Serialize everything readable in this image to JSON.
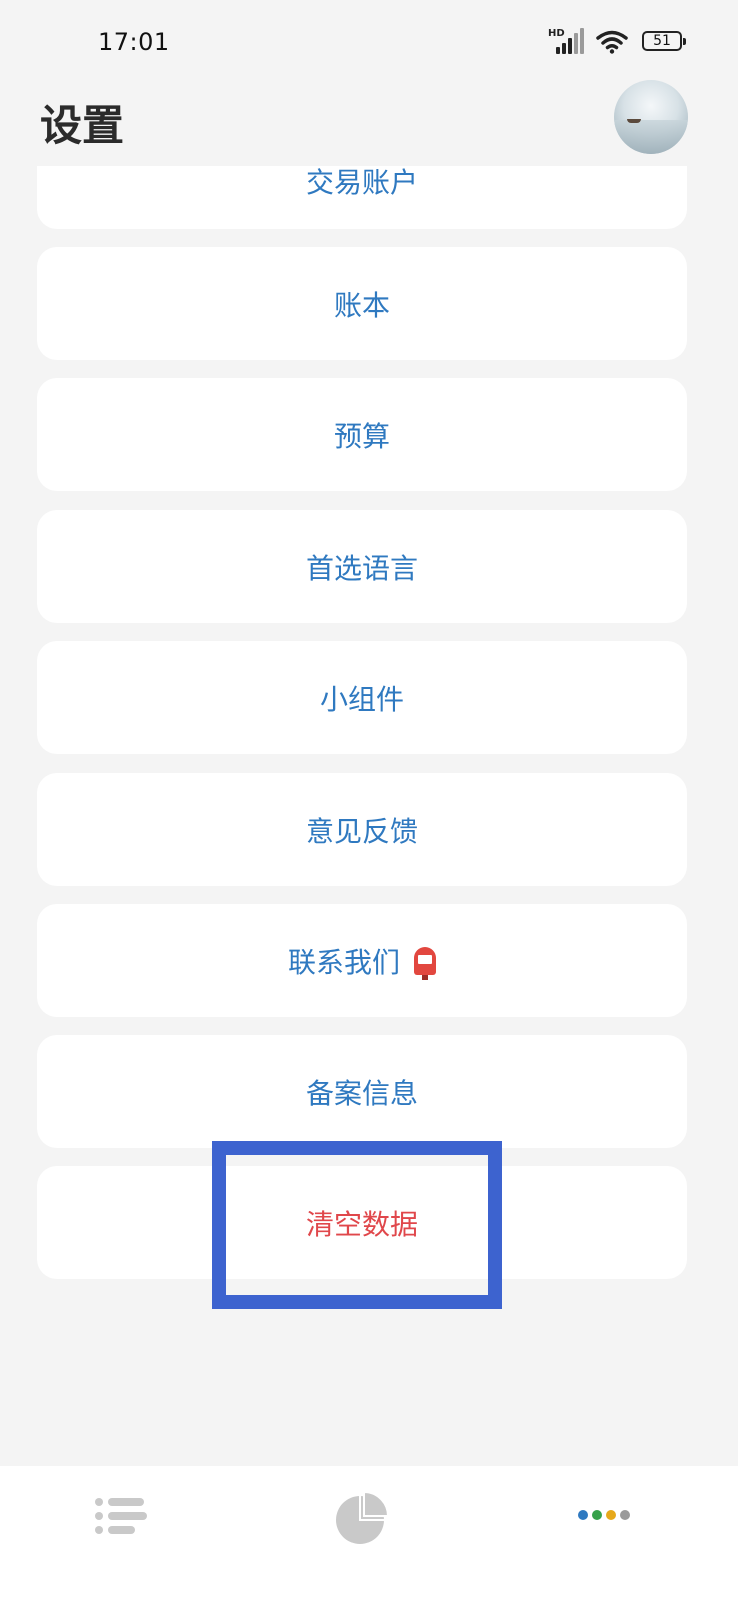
{
  "status_bar": {
    "time": "17:01",
    "network_label": "HD",
    "battery": "51"
  },
  "header": {
    "title": "设置"
  },
  "settings": {
    "items": [
      {
        "label": "交易账户"
      },
      {
        "label": "账本"
      },
      {
        "label": "预算"
      },
      {
        "label": "首选语言"
      },
      {
        "label": "小组件"
      },
      {
        "label": "意见反馈"
      },
      {
        "label": "联系我们",
        "icon": "mailbox-icon"
      },
      {
        "label": "备案信息"
      },
      {
        "label": "清空数据",
        "style": "danger"
      }
    ]
  },
  "bottom_nav": {
    "items": [
      {
        "icon": "list-icon"
      },
      {
        "icon": "pie-chart-icon"
      },
      {
        "icon": "settings-icon"
      }
    ]
  },
  "colors": {
    "accent": "#2f79c0",
    "danger": "#e0474b",
    "highlight": "#3d63cf",
    "background": "#f4f4f4"
  }
}
